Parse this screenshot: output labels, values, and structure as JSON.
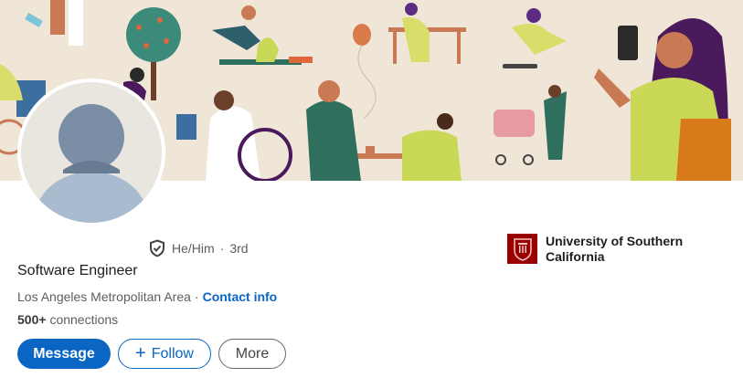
{
  "profile": {
    "pronouns": "He/Him",
    "separator": "·",
    "degree": "3rd",
    "headline": "Software Engineer",
    "location": "Los Angeles Metropolitan Area",
    "location_separator": "·",
    "contact_info": "Contact info",
    "connections_count": "500+",
    "connections_label": "connections"
  },
  "actions": {
    "message": "Message",
    "follow_icon": "+",
    "follow": "Follow",
    "more": "More"
  },
  "education": {
    "school": "University of Southern California",
    "logo_icon": "usc-seal-icon"
  },
  "icons": {
    "verified": "shield-check-icon",
    "follow": "plus-icon"
  },
  "colors": {
    "accent": "#0a66c2",
    "banner_bg": "#f0e6d8",
    "school_brand": "#990000"
  }
}
